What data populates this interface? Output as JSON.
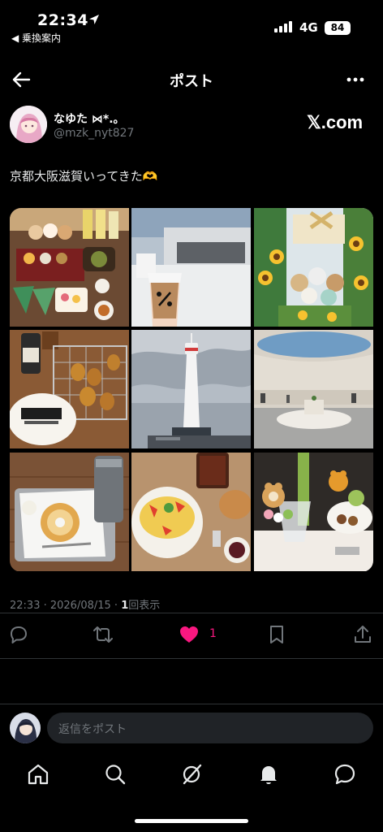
{
  "status_bar": {
    "time": "22:34",
    "back_app": "◀ 乗換案内",
    "network": "4G",
    "battery": "84"
  },
  "header": {
    "title": "ポスト"
  },
  "author": {
    "display_name": "なゆた ⋈*.。",
    "handle": "@mzk_nyt827",
    "source_badge": "𝕏.com"
  },
  "post": {
    "text": "京都大阪滋賀いってきた🫶",
    "photos": [
      {
        "icon": "restaurant-photo"
      },
      {
        "icon": "coffee-cup-photo"
      },
      {
        "icon": "sunflower-plush-photo"
      },
      {
        "icon": "kushikatsu-photo"
      },
      {
        "icon": "kyoto-tower-photo"
      },
      {
        "icon": "plaza-photo"
      },
      {
        "icon": "baumkuchen-photo"
      },
      {
        "icon": "omurice-photo"
      },
      {
        "icon": "parfait-photo"
      }
    ]
  },
  "meta": {
    "timestamp": "22:33 · 2026/08/15 · ",
    "views_count": "1",
    "views_label": "回表示"
  },
  "actions": {
    "like_count": "1"
  },
  "reply": {
    "placeholder": "返信をポスト"
  },
  "colors": {
    "background": "#000000",
    "text": "#e7e9ea",
    "muted": "#71767b",
    "like": "#f91880",
    "divider": "#2f3336"
  }
}
